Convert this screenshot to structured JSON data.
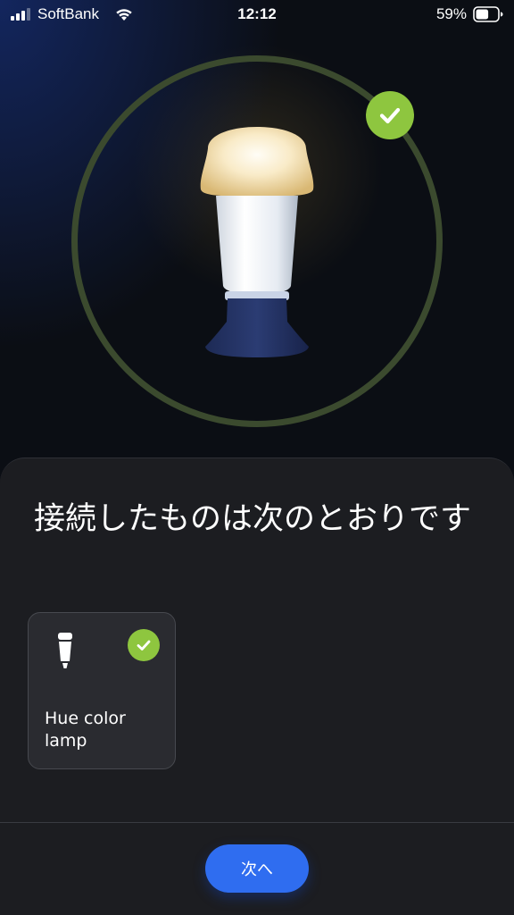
{
  "status_bar": {
    "carrier": "SoftBank",
    "time": "12:12",
    "battery_percent": "59%",
    "battery_level": 0.59,
    "icons": [
      "signal-icon",
      "wifi-icon",
      "battery-icon"
    ]
  },
  "hero": {
    "icons": [
      "bulb-icon",
      "check-icon"
    ],
    "colors": {
      "ring": "#3b4a2e",
      "check": "#8ec63f"
    }
  },
  "sheet": {
    "title": "接続したものは次のとおりです",
    "devices": [
      {
        "name": "Hue color lamp",
        "icon": "bulb-icon",
        "status_icon": "check-icon"
      }
    ],
    "next_label": "次へ"
  },
  "colors": {
    "accent": "#2f6df0",
    "success": "#8ec63f",
    "sheet_background": "#1c1d21",
    "card_background": "#2a2b30"
  }
}
